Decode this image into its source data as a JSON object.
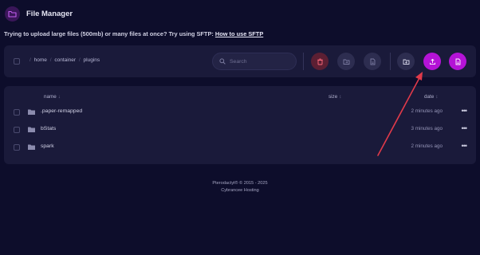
{
  "header": {
    "title": "File Manager"
  },
  "notice": {
    "text": "Trying to upload large files (500mb) or many files at once? Try using SFTP: ",
    "link": "How to use SFTP"
  },
  "breadcrumb": [
    "home",
    "container",
    "plugins"
  ],
  "search": {
    "placeholder": "Search"
  },
  "toolbar": {
    "buttons": [
      "trash-icon",
      "move-folder-icon",
      "archive-file-icon",
      "new-folder-icon",
      "upload-icon",
      "new-file-icon"
    ]
  },
  "table": {
    "headers": {
      "name": "name",
      "size": "size",
      "date": "date"
    },
    "rows": [
      {
        "name": ".paper-remapped",
        "date": "2 minutes ago"
      },
      {
        "name": "bStats",
        "date": "3 minutes ago"
      },
      {
        "name": "spark",
        "date": "2 minutes ago"
      }
    ]
  },
  "footer": {
    "line1": "Pterodactyl® © 2015 - 2025",
    "line2": "Cybrancee Hosting"
  },
  "colors": {
    "background": "#0d0d2b",
    "panel": "#1a1a3a",
    "accent": "#b413d6",
    "danger": "#5c1f33",
    "annotation": "#e03a4a"
  }
}
